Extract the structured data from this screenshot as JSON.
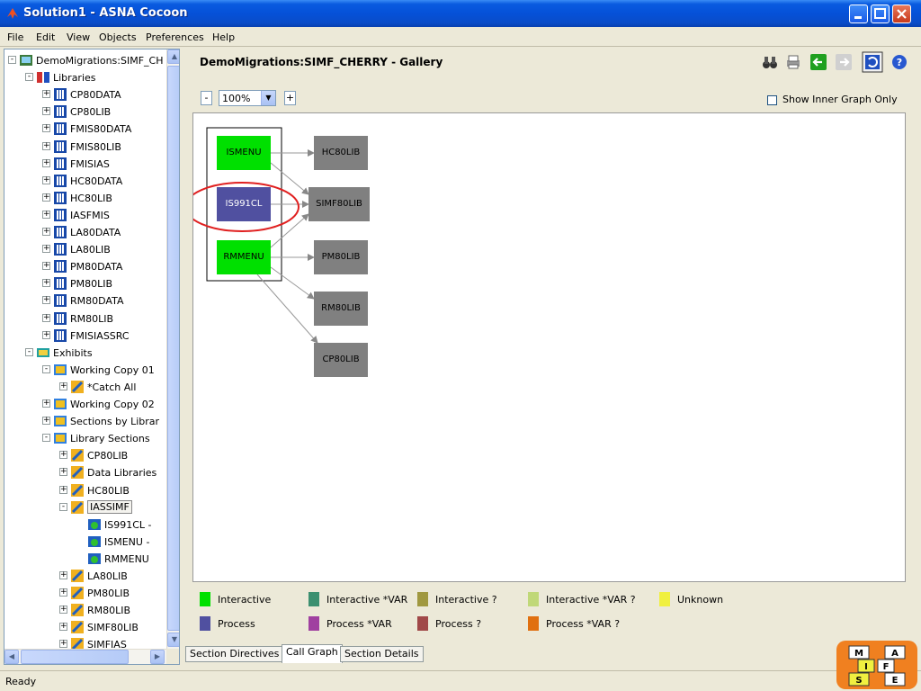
{
  "window": {
    "title": "Solution1 - ASNA Cocoon"
  },
  "menu": [
    "File",
    "Edit",
    "View",
    "Objects",
    "Preferences",
    "Help"
  ],
  "tree": [
    {
      "label": "DemoMigrations:SIMF_CH",
      "indent": 0,
      "toggle": "-",
      "icon": "project-icon"
    },
    {
      "label": "Libraries",
      "indent": 1,
      "toggle": "-",
      "icon": "libraries-icon"
    },
    {
      "label": "CP80DATA",
      "indent": 2,
      "toggle": "+",
      "icon": "library-icon"
    },
    {
      "label": "CP80LIB",
      "indent": 2,
      "toggle": "+",
      "icon": "library-icon"
    },
    {
      "label": "FMIS80DATA",
      "indent": 2,
      "toggle": "+",
      "icon": "library-icon"
    },
    {
      "label": "FMIS80LIB",
      "indent": 2,
      "toggle": "+",
      "icon": "library-icon"
    },
    {
      "label": "FMISIAS",
      "indent": 2,
      "toggle": "+",
      "icon": "library-icon"
    },
    {
      "label": "HC80DATA",
      "indent": 2,
      "toggle": "+",
      "icon": "library-icon"
    },
    {
      "label": "HC80LIB",
      "indent": 2,
      "toggle": "+",
      "icon": "library-icon"
    },
    {
      "label": "IASFMIS",
      "indent": 2,
      "toggle": "+",
      "icon": "library-icon"
    },
    {
      "label": "LA80DATA",
      "indent": 2,
      "toggle": "+",
      "icon": "library-icon"
    },
    {
      "label": "LA80LIB",
      "indent": 2,
      "toggle": "+",
      "icon": "library-icon"
    },
    {
      "label": "PM80DATA",
      "indent": 2,
      "toggle": "+",
      "icon": "library-icon"
    },
    {
      "label": "PM80LIB",
      "indent": 2,
      "toggle": "+",
      "icon": "library-icon"
    },
    {
      "label": "RM80DATA",
      "indent": 2,
      "toggle": "+",
      "icon": "library-icon"
    },
    {
      "label": "RM80LIB",
      "indent": 2,
      "toggle": "+",
      "icon": "library-icon"
    },
    {
      "label": "FMISIASSRC",
      "indent": 2,
      "toggle": "+",
      "icon": "library-icon"
    },
    {
      "label": "Exhibits",
      "indent": 1,
      "toggle": "-",
      "icon": "exhibits-icon"
    },
    {
      "label": "Working Copy 01",
      "indent": 2,
      "toggle": "-",
      "icon": "exhibit-icon"
    },
    {
      "label": "*Catch All",
      "indent": 3,
      "toggle": "+",
      "icon": "section-icon"
    },
    {
      "label": "Working Copy 02",
      "indent": 2,
      "toggle": "+",
      "icon": "exhibit-icon"
    },
    {
      "label": "Sections by Librar",
      "indent": 2,
      "toggle": "+",
      "icon": "exhibit-icon"
    },
    {
      "label": "Library Sections",
      "indent": 2,
      "toggle": "-",
      "icon": "exhibit-icon"
    },
    {
      "label": "CP80LIB",
      "indent": 3,
      "toggle": "+",
      "icon": "section-icon"
    },
    {
      "label": "Data Libraries",
      "indent": 3,
      "toggle": "+",
      "icon": "section-icon"
    },
    {
      "label": "HC80LIB",
      "indent": 3,
      "toggle": "+",
      "icon": "section-icon"
    },
    {
      "label": "IASSIMF",
      "indent": 3,
      "toggle": "-",
      "icon": "section-icon",
      "selected": true
    },
    {
      "label": "IS991CL -",
      "indent": 4,
      "toggle": "",
      "icon": "program-icon"
    },
    {
      "label": "ISMENU -",
      "indent": 4,
      "toggle": "",
      "icon": "program-icon"
    },
    {
      "label": "RMMENU",
      "indent": 4,
      "toggle": "",
      "icon": "program-icon"
    },
    {
      "label": "LA80LIB",
      "indent": 3,
      "toggle": "+",
      "icon": "section-icon"
    },
    {
      "label": "PM80LIB",
      "indent": 3,
      "toggle": "+",
      "icon": "section-icon"
    },
    {
      "label": "RM80LIB",
      "indent": 3,
      "toggle": "+",
      "icon": "section-icon"
    },
    {
      "label": "SIMF80LIB",
      "indent": 3,
      "toggle": "+",
      "icon": "section-icon"
    },
    {
      "label": "SIMFIAS",
      "indent": 3,
      "toggle": "+",
      "icon": "section-icon"
    }
  ],
  "gallery": {
    "title": "DemoMigrations:SIMF_CHERRY - Gallery"
  },
  "zoom": {
    "minus": "-",
    "plus": "+",
    "value": "100%"
  },
  "show_inner": {
    "label": "Show Inner Graph Only",
    "checked": false
  },
  "graph": {
    "nodes": [
      {
        "id": "ISMENU",
        "label": "ISMENU",
        "kind": "interactive"
      },
      {
        "id": "IS991CL",
        "label": "IS991CL",
        "kind": "process"
      },
      {
        "id": "RMMENU",
        "label": "RMMENU",
        "kind": "interactive"
      },
      {
        "id": "HC80LIB",
        "label": "HC80LIB",
        "kind": "library"
      },
      {
        "id": "SIMF80LIB",
        "label": "SIMF80LIB",
        "kind": "library"
      },
      {
        "id": "PM80LIB",
        "label": "PM80LIB",
        "kind": "library"
      },
      {
        "id": "RM80LIB",
        "label": "RM80LIB",
        "kind": "library"
      },
      {
        "id": "CP80LIB",
        "label": "CP80LIB",
        "kind": "library"
      }
    ],
    "edges": [
      [
        "ISMENU",
        "HC80LIB"
      ],
      [
        "ISMENU",
        "SIMF80LIB"
      ],
      [
        "IS991CL",
        "SIMF80LIB"
      ],
      [
        "RMMENU",
        "SIMF80LIB"
      ],
      [
        "RMMENU",
        "PM80LIB"
      ],
      [
        "RMMENU",
        "RM80LIB"
      ],
      [
        "RMMENU",
        "CP80LIB"
      ]
    ],
    "highlighted": "IS991CL"
  },
  "colors": {
    "interactive": "#00e000",
    "process": "#5050a0",
    "library": "#808080",
    "highlight": "#e02020"
  },
  "legend": [
    {
      "label": "Interactive",
      "color": "#00e000"
    },
    {
      "label": "Interactive *VAR",
      "color": "#3c9070"
    },
    {
      "label": "Interactive ?",
      "color": "#a09840"
    },
    {
      "label": "Interactive *VAR ?",
      "color": "#c0d878"
    },
    {
      "label": "Unknown",
      "color": "#f0f040"
    },
    {
      "label": "Process",
      "color": "#5050a0"
    },
    {
      "label": "Process *VAR",
      "color": "#a040a0"
    },
    {
      "label": "Process ?",
      "color": "#a04848"
    },
    {
      "label": "Process *VAR ?",
      "color": "#e07010"
    }
  ],
  "tabs": [
    {
      "label": "Section Directives",
      "active": false
    },
    {
      "label": "Call Graph",
      "active": true
    },
    {
      "label": "Section Details",
      "active": false
    }
  ],
  "status": "Ready",
  "logo": {
    "letters": [
      "M",
      "A",
      "I",
      "F",
      "S",
      "E"
    ]
  }
}
